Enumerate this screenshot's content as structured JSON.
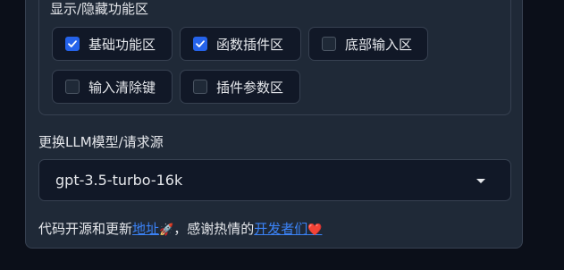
{
  "section": {
    "label": "显示/隐藏功能区",
    "checkboxes": [
      {
        "label": "基础功能区",
        "checked": true
      },
      {
        "label": "函数插件区",
        "checked": true
      },
      {
        "label": "底部输入区",
        "checked": false
      },
      {
        "label": "输入清除键",
        "checked": false
      },
      {
        "label": "插件参数区",
        "checked": false
      }
    ]
  },
  "model": {
    "label": "更换LLM模型/请求源",
    "selected": "gpt-3.5-turbo-16k"
  },
  "footer": {
    "prefix": "代码开源和更新",
    "link1": "地址",
    "rocket": "🚀",
    "middle": "，感谢热情的",
    "link2": "开发者们",
    "heart": "❤️"
  },
  "colors": {
    "accent": "#2563eb",
    "link": "#3b82f6",
    "background": "#0b0f19",
    "panel": "#1f2937"
  }
}
